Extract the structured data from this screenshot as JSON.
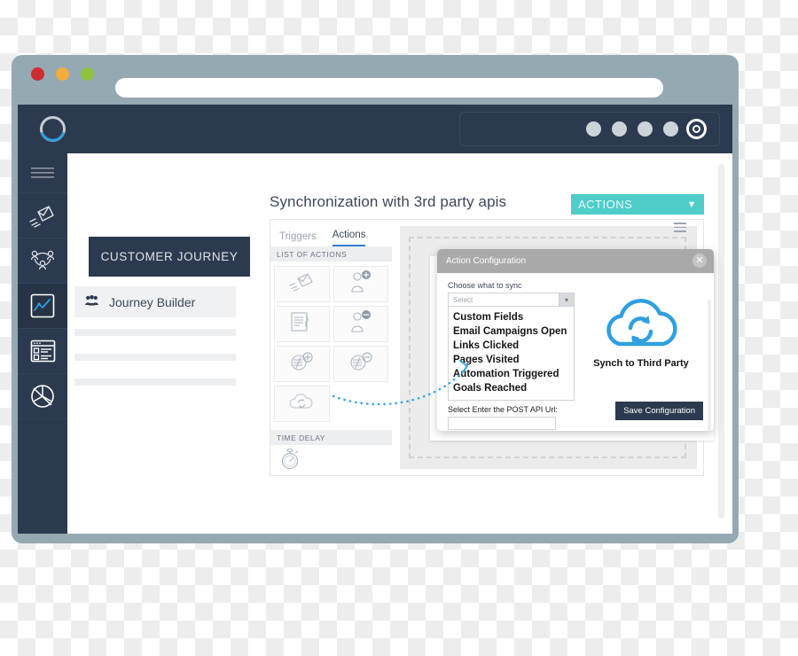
{
  "browser": {
    "traffic_lights": [
      {
        "name": "close",
        "color": "#cf2c34"
      },
      {
        "name": "minimize",
        "color": "#f3ad3d"
      },
      {
        "name": "maximize",
        "color": "#91c240"
      }
    ],
    "url_value": "",
    "url_placeholder": ""
  },
  "topbar": {
    "logo_name": "circle-loader-logo",
    "nav_dots": [
      "nav-dot-1",
      "nav-dot-2",
      "nav-dot-3",
      "nav-dot-4",
      "nav-dot-active"
    ]
  },
  "rail": {
    "items": [
      {
        "icon": "hamburger-menu-icon",
        "label": "Menu",
        "active": false
      },
      {
        "icon": "paper-plane-envelope-icon",
        "label": "Campaigns",
        "active": false
      },
      {
        "icon": "contacts-group-icon",
        "label": "Contacts",
        "active": false
      },
      {
        "icon": "journey-chart-icon",
        "label": "Customer Journey",
        "active": true
      },
      {
        "icon": "forms-list-icon",
        "label": "Forms",
        "active": false
      },
      {
        "icon": "pie-chart-icon",
        "label": "Reports",
        "active": false
      }
    ]
  },
  "sidebar": {
    "tooltip": "CUSTOMER JOURNEY",
    "selected_item": {
      "icon": "group-people-icon",
      "label": "Journey Builder"
    },
    "placeholder_rows": 4
  },
  "main": {
    "title": "Synchronization with 3rd party apis",
    "actions_button": {
      "label": "ACTIONS",
      "caret": "▼",
      "color": "#4ecdc9"
    }
  },
  "builder": {
    "tabs": [
      {
        "label": "Triggers",
        "active": false
      },
      {
        "label": "Actions",
        "active": true
      }
    ],
    "list_header": "LIST OF ACTIONS",
    "action_tiles": [
      "send-email-icon",
      "add-contact-icon",
      "edit-note-icon",
      "remove-contact-icon",
      "add-score-icon",
      "remove-score-icon",
      "cloud-sync-icon"
    ],
    "time_delay_header": "TIME DELAY",
    "time_delay_tile": "stopwatch-icon",
    "canvas_menu_icon": "hamburger-menu-icon"
  },
  "modal": {
    "title": "Action Configuration",
    "close_icon": "close-icon",
    "sync_field_label": "Choose what to sync",
    "select_value": "Select",
    "select_caret": "⌄",
    "options": [
      "Custom Fields",
      "Email Campaigns Open",
      "Links Clicked",
      "Pages Visited",
      "Automation Triggered",
      "Goals Reached"
    ],
    "api_label": "Select  Enter the POST API Url:",
    "api_value": "",
    "cloud_icon": "cloud-sync-icon",
    "cloud_caption": "Synch to Third Party",
    "save_label": "Save Configuration"
  }
}
